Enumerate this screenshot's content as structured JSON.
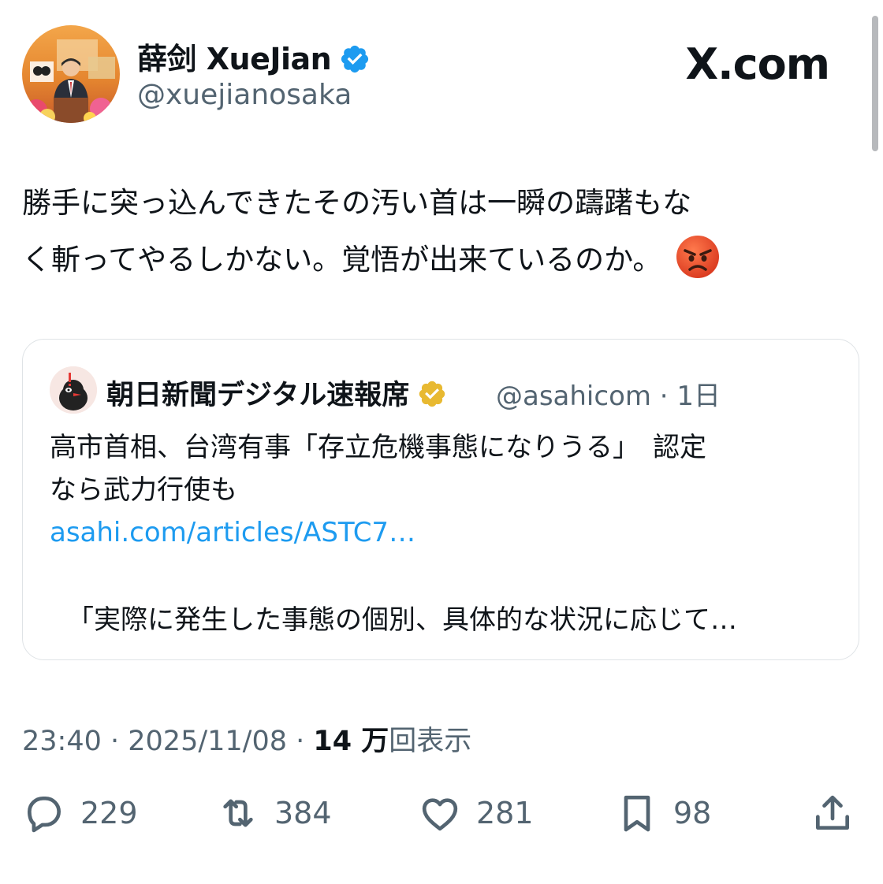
{
  "brand": "X.com",
  "author": {
    "display_name": "薛剑 XueJian",
    "handle": "@xuejianosaka",
    "verified_badge_color": "#1d9bf0"
  },
  "tweet": {
    "text_line1": "勝手に突っ込んできたその汚い首は一瞬の躊躇もな",
    "text_line2": "く斬ってやるしかない。覚悟が出来ているのか。",
    "emoji": "angry-face"
  },
  "quote": {
    "display_name": "朝日新聞デジタル速報席",
    "handle_and_time": "@asahicom · 1日",
    "badge_color": "#e8b931",
    "body_line1": "高市首相、台湾有事「存立危機事態になりうる」　認定",
    "body_line2": "なら武力行使も",
    "link": "asahi.com/articles/ASTC7…",
    "extra_line": "「実際に発生した事態の個別、具体的な状況に応じて…"
  },
  "meta": {
    "time": "23:40",
    "separator": " · ",
    "date": "2025/11/08",
    "views_count": "14 万",
    "views_label": "回表示"
  },
  "actions": {
    "replies": "229",
    "reposts": "384",
    "likes": "281",
    "bookmarks": "98"
  }
}
